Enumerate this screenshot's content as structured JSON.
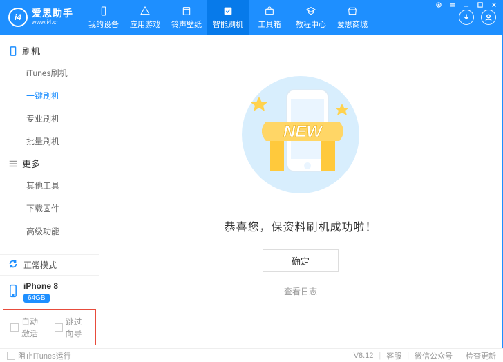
{
  "brand": {
    "title": "爱思助手",
    "url": "www.i4.cn",
    "logo_text": "i4"
  },
  "nav": {
    "items": [
      {
        "label": "我的设备"
      },
      {
        "label": "应用游戏"
      },
      {
        "label": "铃声壁纸"
      },
      {
        "label": "智能刷机"
      },
      {
        "label": "工具箱"
      },
      {
        "label": "教程中心"
      },
      {
        "label": "爱思商城"
      }
    ]
  },
  "sidebar": {
    "section_flash": "刷机",
    "flash_items": [
      "iTunes刷机",
      "一键刷机",
      "专业刷机",
      "批量刷机"
    ],
    "section_more": "更多",
    "more_items": [
      "其他工具",
      "下载固件",
      "高级功能"
    ],
    "status_mode": "正常模式",
    "device_name": "iPhone 8",
    "device_badge": "64GB",
    "auto_activate": "自动激活",
    "skip_guide": "跳过向导"
  },
  "main": {
    "new_text": "NEW",
    "success_title": "恭喜您，保资料刷机成功啦！",
    "ok_button": "确定",
    "log_link": "查看日志"
  },
  "footer": {
    "block_itunes": "阻止iTunes运行",
    "version": "V8.12",
    "service": "客服",
    "wechat": "微信公众号",
    "update": "检查更新"
  }
}
